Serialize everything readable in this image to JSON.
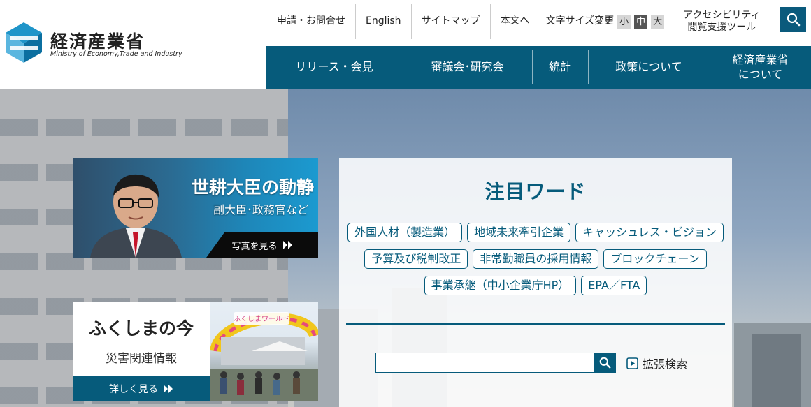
{
  "brand": {
    "name": "経済産業省",
    "name_en": "Ministry of Economy,Trade and Industry",
    "primary_color": "#065b7b"
  },
  "utility_nav": {
    "contact": "申請・お問合せ",
    "english": "English",
    "sitemap": "サイトマップ",
    "skip_to_content": "本文へ",
    "font_size_label": "文字サイズ変更",
    "font_sizes": [
      "小",
      "中",
      "大"
    ],
    "font_size_selected": "中",
    "accessibility_line1": "アクセシビリティ",
    "accessibility_line2": "閲覧支援ツール",
    "search_icon": "search-icon"
  },
  "global_nav": {
    "items": [
      {
        "label": "リリース・会見"
      },
      {
        "label": "審議会･研究会"
      },
      {
        "label": "統計"
      },
      {
        "label": "政策について"
      },
      {
        "label_line1": "経済産業省",
        "label_line2": "について"
      }
    ]
  },
  "minister_banner": {
    "title": "世耕大臣の動静",
    "subtitle": "副大臣･政務官など",
    "more": "写真を見る"
  },
  "fukushima_banner": {
    "title": "ふくしまの今",
    "subtitle": "災害関連情報",
    "more": "詳しく見る",
    "sign_text": "ふくしまワールド"
  },
  "keywords": {
    "title": "注目ワード",
    "rows": [
      [
        "外国人材（製造業）",
        "地域未来牽引企業",
        "キャッシュレス・ビジョン"
      ],
      [
        "予算及び税制改正",
        "非常勤職員の採用情報",
        "ブロックチェーン"
      ],
      [
        "事業承継（中小企業庁HP）",
        "EPA／FTA"
      ]
    ]
  },
  "search": {
    "value": "",
    "placeholder": "",
    "advanced": "拡張検索"
  }
}
